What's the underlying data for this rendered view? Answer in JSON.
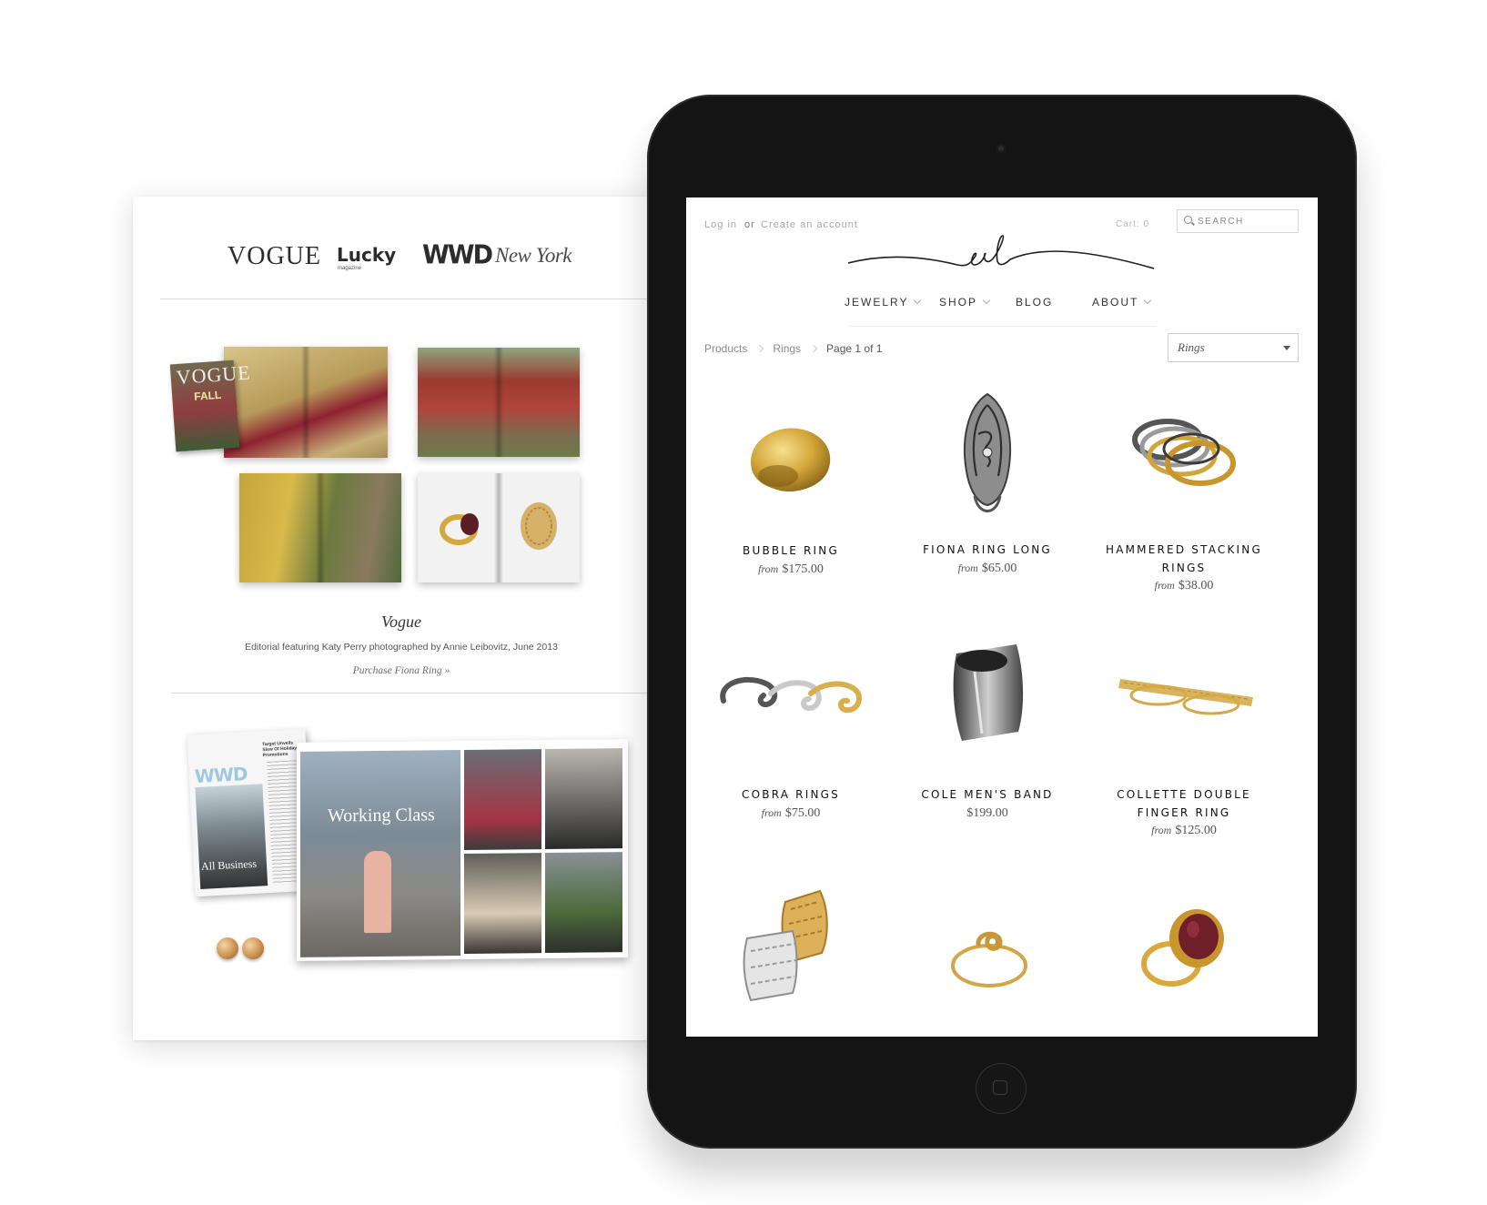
{
  "press": {
    "logos": {
      "vogue": "VOGUE",
      "lucky": "Lucky",
      "lucky_sub": "magazine",
      "wwd": "WWD",
      "newyork": "New York"
    },
    "cover_title": "VOGUE",
    "cover_subtitle": "FALL",
    "feature_title": "Vogue",
    "feature_caption": "Editorial featuring Katy Perry photographed by Annie Leibovitz, June 2013",
    "feature_link": "Purchase Fiona Ring »",
    "wwd_page_logo": "WWD",
    "wwd_page_headline": "Target Unveils Slew Of Holiday Promotions",
    "wwd_page_caption": "All Business",
    "ny_headline": "Working Class"
  },
  "store": {
    "login_label": "Log in",
    "or_label": "or",
    "create_account_label": "Create an account",
    "cart_label": "Cart: 0",
    "search_placeholder": "SEARCH",
    "logo_text": "vl",
    "nav": [
      {
        "label": "JEWELRY",
        "has_dropdown": true
      },
      {
        "label": "SHOP",
        "has_dropdown": true
      },
      {
        "label": "BLOG",
        "has_dropdown": false
      },
      {
        "label": "ABOUT",
        "has_dropdown": true
      }
    ],
    "breadcrumb": [
      "Products",
      "Rings",
      "Page 1 of 1"
    ],
    "filter_value": "Rings",
    "from_label": "from",
    "products": [
      {
        "name": "BUBBLE RING",
        "price": "$175.00",
        "has_from": true
      },
      {
        "name": "FIONA RING LONG",
        "price": "$65.00",
        "has_from": true
      },
      {
        "name_line1": "HAMMERED STACKING",
        "name_line2": "RINGS",
        "price": "$38.00",
        "has_from": true
      },
      {
        "name": "COBRA RINGS",
        "price": "$75.00",
        "has_from": true
      },
      {
        "name": "COLE MEN'S BAND",
        "price": "$199.00",
        "has_from": false
      },
      {
        "name_line1": "COLLETTE DOUBLE",
        "name_line2": "FINGER RING",
        "price": "$125.00",
        "has_from": true
      }
    ]
  },
  "colors": {
    "gold": "#c9a13a",
    "silver": "#9a9a9a",
    "tablet_bezel": "#141414",
    "garnet": "#6e1f2a"
  }
}
